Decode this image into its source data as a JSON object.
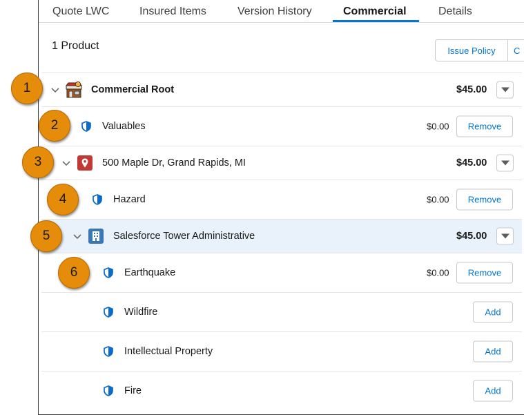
{
  "tabs": [
    {
      "label": "Quote LWC"
    },
    {
      "label": "Insured Items"
    },
    {
      "label": "Version History"
    },
    {
      "label": "Commercial",
      "active": true
    },
    {
      "label": "Details"
    }
  ],
  "header": {
    "product_count": "1 Product",
    "issue_policy_label": "Issue Policy",
    "clipped_button_label": "C"
  },
  "rows": [
    {
      "label": "Commercial Root",
      "price": "$45.00",
      "icon": "shop-icon"
    },
    {
      "label": "Valuables",
      "price": "$0.00",
      "action": "Remove",
      "icon": "shield-icon"
    },
    {
      "label": "500 Maple Dr, Grand Rapids, MI",
      "price": "$45.00",
      "icon": "location-pin-icon"
    },
    {
      "label": "Hazard",
      "price": "$0.00",
      "action": "Remove",
      "icon": "shield-icon"
    },
    {
      "label": "Salesforce Tower Administrative",
      "price": "$45.00",
      "icon": "building-icon"
    },
    {
      "label": "Earthquake",
      "price": "$0.00",
      "action": "Remove",
      "icon": "shield-icon"
    },
    {
      "label": "Wildfire",
      "action": "Add",
      "icon": "shield-icon"
    },
    {
      "label": "Intellectual Property",
      "action": "Add",
      "icon": "shield-icon"
    },
    {
      "label": "Fire",
      "action": "Add",
      "icon": "shield-icon"
    }
  ],
  "callouts": [
    "1",
    "2",
    "3",
    "4",
    "5",
    "6"
  ],
  "colors": {
    "accent": "#0176d3",
    "callout": "#e58c0a",
    "highlight_row": "#e9f2fb",
    "pin_icon_bg": "#c23934",
    "building_icon_bg": "#3a77b5"
  }
}
